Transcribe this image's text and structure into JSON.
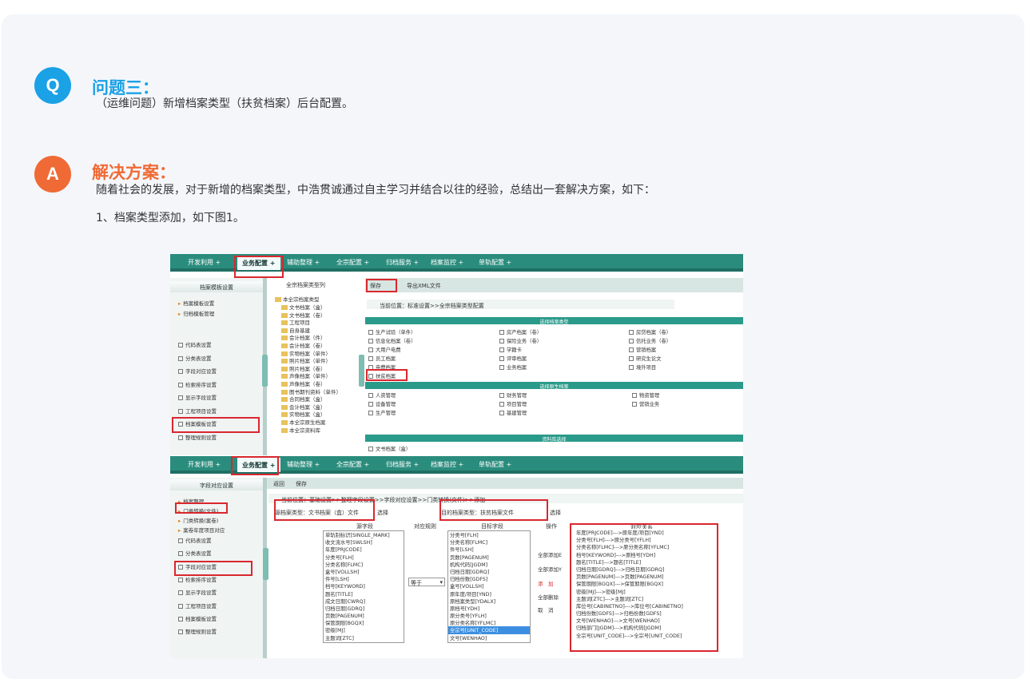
{
  "question": {
    "badge": "Q",
    "title": "问题三：",
    "text": "（运维问题）新增档案类型（扶贫档案）后台配置。"
  },
  "answer": {
    "badge": "A",
    "title": "解决方案：",
    "line1": "随着社会的发展，对于新增的档案类型，中浩贯诚通过自主学习并结合以往的经验，总结出一套解决方案，如下：",
    "line2": "1、档案类型添加，如下图1。"
  },
  "nav_tabs": [
    "开发利用",
    "业务配置",
    "辅助整理",
    "全宗配置",
    "归档服务",
    "档案监控",
    "单轨配置"
  ],
  "top": {
    "left_title": "档案模板设置",
    "left_items_top": [
      "档案模板设置",
      "归档模板管理"
    ],
    "left_items": [
      "代码表设置",
      "分类表设置",
      "字段对应设置",
      "检索排序设置",
      "显示字段设置",
      "工程项目设置",
      "档案模板设置",
      "整理规则设置"
    ],
    "tree_title": "全宗档案类型列",
    "tree_root": "本全宗档案类型",
    "tree_items": [
      "文书档案（盒）",
      "文书档案（卷）",
      "工程项目",
      "自身基建",
      "会计档案（件）",
      "会计档案（卷）",
      "实物档案（单件）",
      "照片档案（单件）",
      "照片档案（卷）",
      "声像档案（单件）",
      "声像档案（卷）",
      "图书期刊资料（单件）",
      "合同档案（盒）",
      "会计档案（盒）",
      "实物档案（盒）",
      "本全宗原生档案",
      "本全宗资料库"
    ],
    "toolbar_save": "保存",
    "toolbar_export": "导出XML文件",
    "location": "当前位置：标准设置>>全宗档案类型配置",
    "sec1": "选择档案类型",
    "types": [
      [
        "生产试验（单件）",
        "房产档案（卷）",
        "房贷档案（卷）"
      ],
      [
        "信息化档案（卷）",
        "保险业务（卷）",
        "信托业务（卷）"
      ],
      [
        "大用户电费",
        "学籍卡",
        "营销档案"
      ],
      [
        "员工档案",
        "评审档案",
        "研究生论文"
      ],
      [
        "电费档案",
        "业务档案",
        "境外项目"
      ]
    ],
    "new_type": "扶贫档案",
    "sec2": "选择原生档案",
    "natives": [
      [
        "人资管理",
        "财务管理",
        "物资管理"
      ],
      [
        "设备管理",
        "项目管理",
        "营销业务"
      ],
      [
        "生产管理",
        "基建管理",
        ""
      ]
    ],
    "sec3": "资料库选择",
    "lib_item": "文书档案（盒）"
  },
  "bottom": {
    "left_title": "字段对应设置",
    "left_items_top": [
      "档案整理",
      "门类转换(文件)",
      "门类转换(案卷)",
      "案卷年度项目对应"
    ],
    "left_items": [
      "代码表设置",
      "分类表设置",
      "字段对应设置",
      "检索排序设置",
      "显示字段设置",
      "工程项目设置",
      "档案模板设置",
      "整理规则设置"
    ],
    "toolbar_back": "返回",
    "toolbar_save": "保存",
    "location": "当前位置：基础设置>>整理字段设置>>字段对应设置>>门类转换(文件)>>添加",
    "src_label": "源档案类型：文书档案（盒）文件",
    "dst_label": "目的档案类型：扶贫档案文件",
    "select_suffix": "选择",
    "col_src": "源字段",
    "col_rule": "对应规则",
    "col_dst": "目标字段",
    "col_op": "操作",
    "col_map": "对应关系",
    "src_fields": [
      "单轨制标识[SINGLE_MARK]",
      "收文流水号[SWLSH]",
      "年度[PRJCODE]",
      "分类号[FLH]",
      "分类名称[FLMC]",
      "盒号[VOLLSH]",
      "件号[LSH]",
      "档号[KEYWORD]",
      "题名[TITLE]",
      "成文日期[CWRQ]",
      "归档日期[GDRQ]",
      "页数[PAGENUM]",
      "保管期限[BGQX]",
      "密级[MJ]",
      "主题词[ZTC]"
    ],
    "rule_value": "等于",
    "dst_fields": [
      "分类号[FLH]",
      "分类名称[FLMC]",
      "件号[LSH]",
      "页数[PAGENUM]",
      "机构代码[JGDM]",
      "归档日期[GDRQ]",
      "归档份数[GDFS]",
      "盒号[VOLLSH]",
      "原年度/项目[YND]",
      "原档案类型[YDALX]",
      "原档号[YDH]",
      "原分类号[YFLH]",
      "原分类名称[YFLMC]",
      "全宗号[UNIT_CODE]",
      "文号[WENHAO]"
    ],
    "dst_selected_index": 13,
    "ops": [
      "全部添加E",
      "全部添加Y",
      "添　加",
      "全部删除",
      "取　消"
    ],
    "mappings": [
      "年度[PRJCODE]--->原年度/项目[YND]",
      "分类号[FLH]--->原分类号[YFLH]",
      "分类名称[FLMC]--->原分类名称[YFLMC]",
      "档号[KEYWORD]--->原档号[YDH]",
      "题名[TITLE]--->题名[TITLE]",
      "归档日期[GDRQ]--->归档日期[GDRQ]",
      "页数[PAGENUM]--->页数[PAGENUM]",
      "保管期限[BGQX]--->保管期限[BGQX]",
      "密级[MJ]--->密级[MJ]",
      "主题词[ZTC]--->主题词[ZTC]",
      "库位号[CABINETNO]--->库位号[CABINETNO]",
      "归档份数[GDFS]--->归档份数[GDFS]",
      "文号[WENHAO]--->文号[WENHAO]",
      "归档部门[JGDM]--->机构代码[JGDM]",
      "全宗号[UNIT_CODE]--->全宗号[UNIT_CODE]"
    ]
  },
  "colors": {
    "q_accent": "#1aa1e6",
    "a_accent": "#f06a35",
    "nav": "#2a8c7d",
    "highlight": "#d9272e"
  }
}
